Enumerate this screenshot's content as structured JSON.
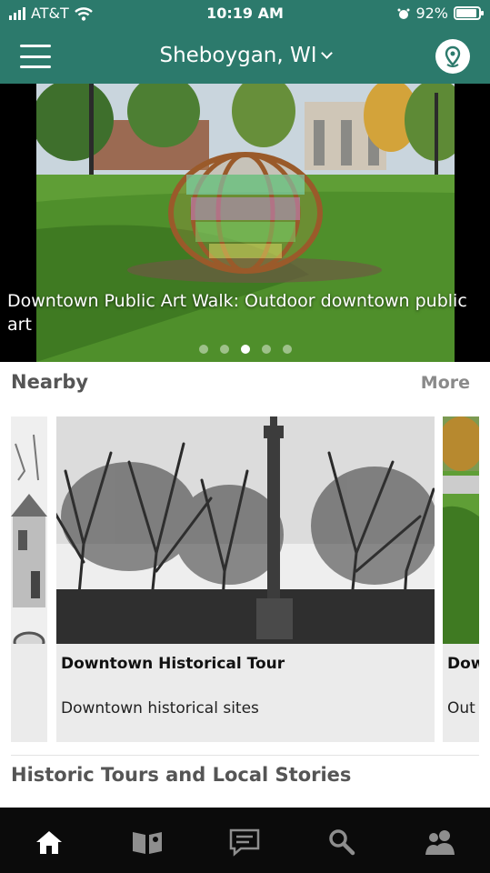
{
  "status_bar": {
    "carrier": "AT&T",
    "time": "10:19 AM",
    "battery": "92%",
    "battery_level": 0.92
  },
  "header": {
    "location": "Sheboygan, WI"
  },
  "carousel": {
    "caption": "Downtown Public Art Walk: Outdoor downtown public art",
    "pages": 5,
    "active_page": 3
  },
  "nearby": {
    "title": "Nearby",
    "more_label": "More",
    "cards": [
      {
        "title": "",
        "subtitle": ""
      },
      {
        "title": "Downtown Historical Tour",
        "subtitle": "Downtown historical sites"
      },
      {
        "title": "Dow",
        "subtitle": "Out"
      }
    ]
  },
  "section2": {
    "title": "Historic Tours and Local Stories"
  },
  "tabs": [
    "home-icon",
    "book-map-icon",
    "chat-icon",
    "search-icon",
    "people-icon"
  ],
  "colors": {
    "brand": "#2c7a6c",
    "tabbar": "#0b0b0b",
    "card_bg": "#ebebeb"
  }
}
